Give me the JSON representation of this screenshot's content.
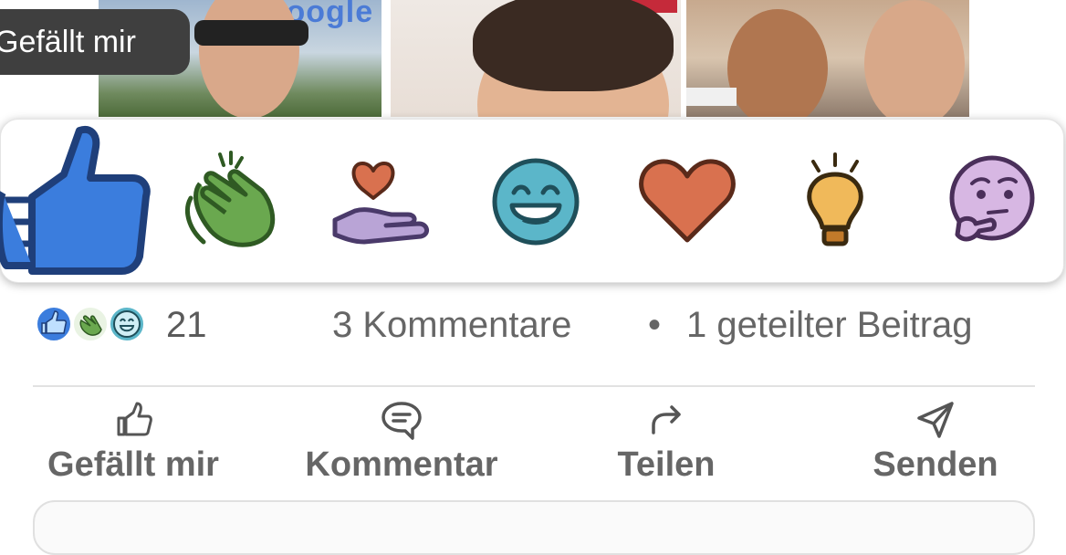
{
  "photos": {
    "tooltip_label": "Gefällt mir",
    "sign_text": "Google"
  },
  "reactions": [
    {
      "name": "like",
      "icon": "thumbs-up-icon",
      "color": "#3b7ddd"
    },
    {
      "name": "celebrate",
      "icon": "clapping-hands-icon",
      "color": "#6aa84f"
    },
    {
      "name": "support",
      "icon": "heart-in-hand-icon",
      "color": "#b9a4d6"
    },
    {
      "name": "funny",
      "icon": "laughing-face-icon",
      "color": "#5bb6c9"
    },
    {
      "name": "love",
      "icon": "heart-icon",
      "color": "#d9714f"
    },
    {
      "name": "insightful",
      "icon": "lightbulb-icon",
      "color": "#f0b95a"
    },
    {
      "name": "curious",
      "icon": "thinking-face-icon",
      "color": "#d7b7e3"
    }
  ],
  "stats": {
    "reaction_count": "21",
    "comments": "3 Kommentare",
    "separator": "•",
    "shares": "1 geteilter Beitrag"
  },
  "actions": {
    "like": "Gefällt mir",
    "comment": "Kommentar",
    "share": "Teilen",
    "send": "Senden"
  }
}
